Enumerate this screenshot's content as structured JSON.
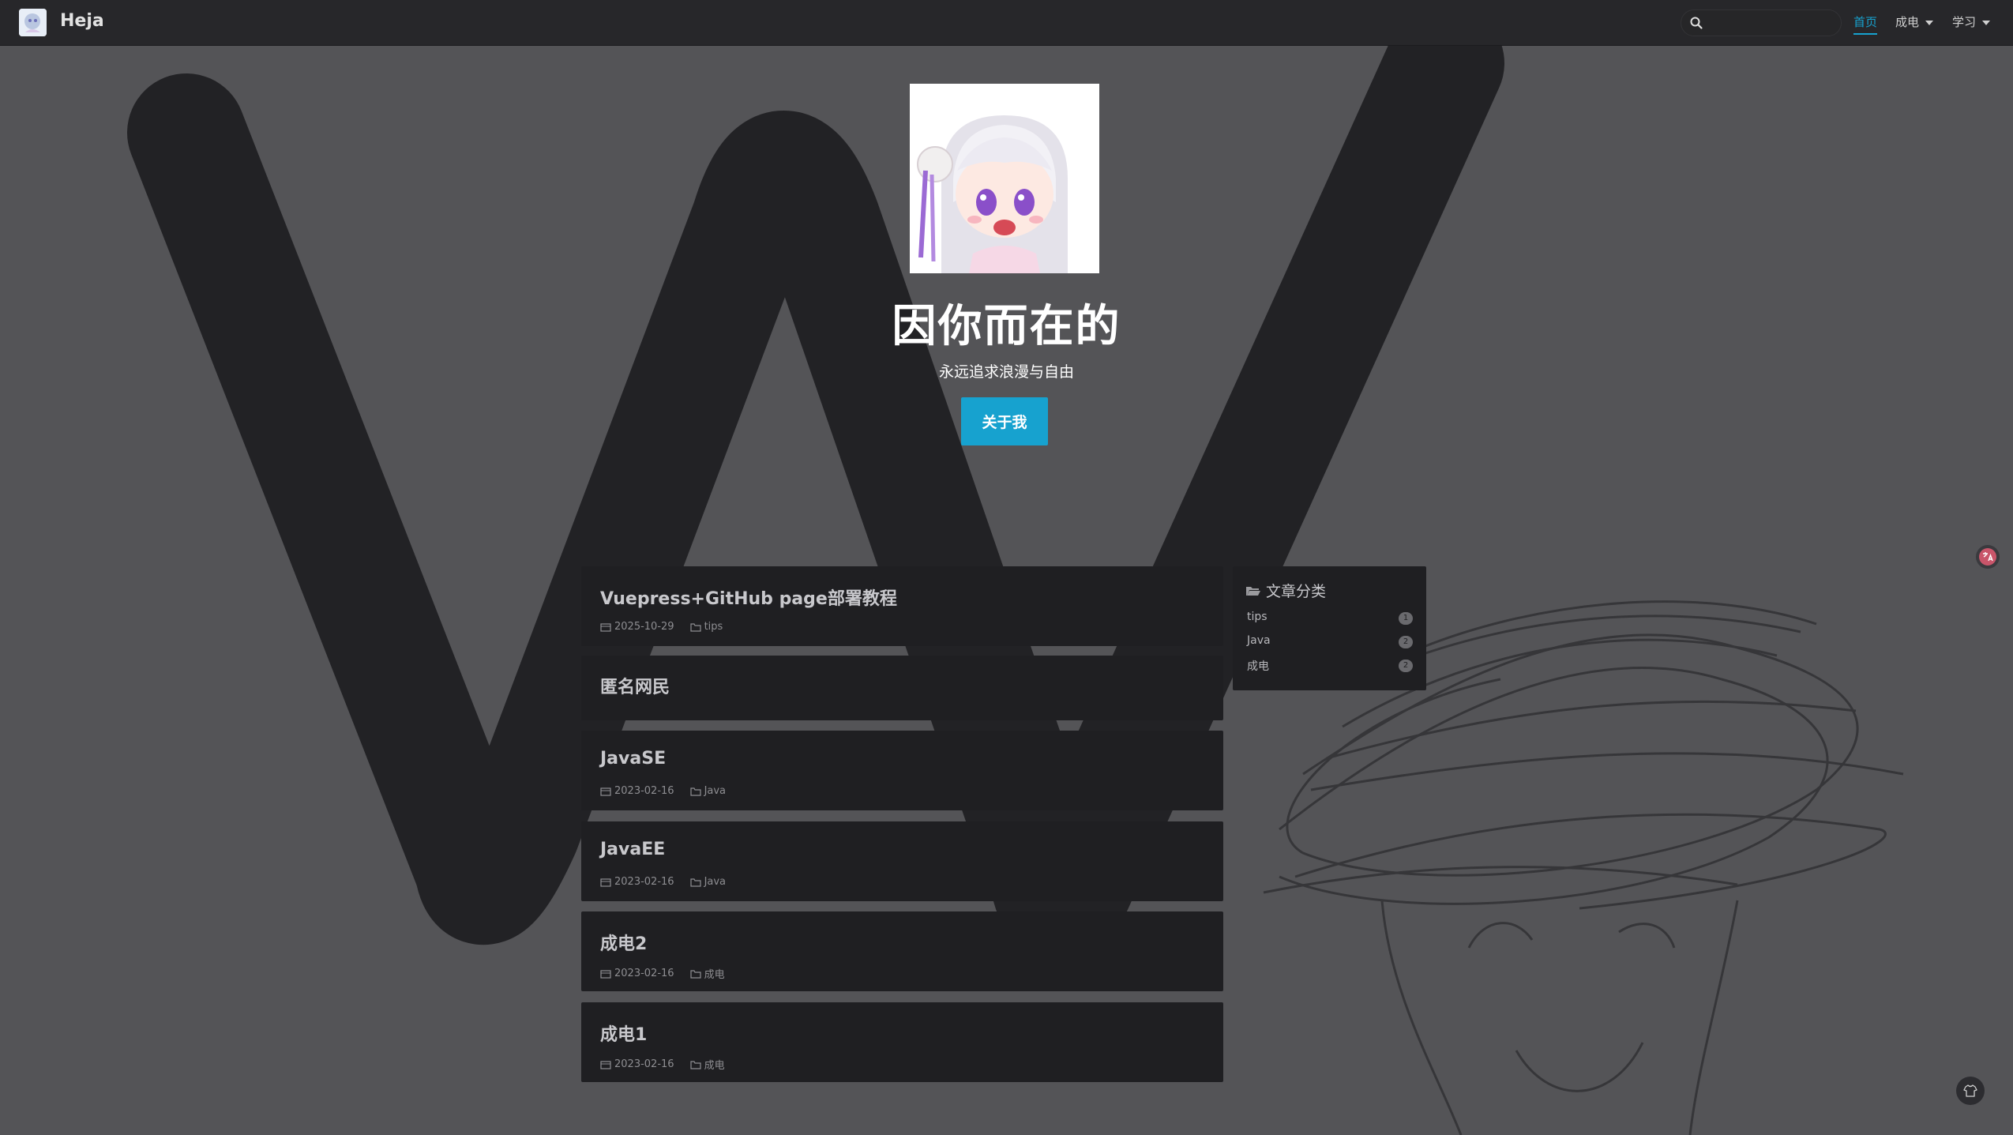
{
  "navbar": {
    "site_title": "Heja",
    "search_placeholder": "",
    "links": [
      {
        "label": "首页",
        "active": true,
        "dropdown": false
      },
      {
        "label": "成电",
        "active": false,
        "dropdown": true
      },
      {
        "label": "学习",
        "active": false,
        "dropdown": true
      }
    ],
    "accent_color": "#17a2cf"
  },
  "hero": {
    "title": "因你而在的",
    "subtitle": "永远追求浪漫与自由",
    "button_label": "关于我"
  },
  "posts": [
    {
      "title": "Vuepress+GitHub page部署教程",
      "date": "2025-10-29",
      "category": "tips"
    },
    {
      "title": "匿名网民",
      "date": "",
      "category": ""
    },
    {
      "title": "JavaSE",
      "date": "2023-02-16",
      "category": "Java"
    },
    {
      "title": "JavaEE",
      "date": "2023-02-16",
      "category": "Java"
    },
    {
      "title": "成电2",
      "date": "2023-02-16",
      "category": "成电"
    },
    {
      "title": "成电1",
      "date": "2023-02-16",
      "category": "成电"
    }
  ],
  "categories": {
    "heading": "文章分类",
    "items": [
      {
        "name": "tips",
        "count": "1"
      },
      {
        "name": "Java",
        "count": "2"
      },
      {
        "name": "成电",
        "count": "2"
      }
    ]
  },
  "icons": {
    "search": "search-icon",
    "folder": "folder-icon",
    "calendar": "calendar-icon",
    "translate": "translate-icon",
    "theme": "shirt-icon"
  }
}
